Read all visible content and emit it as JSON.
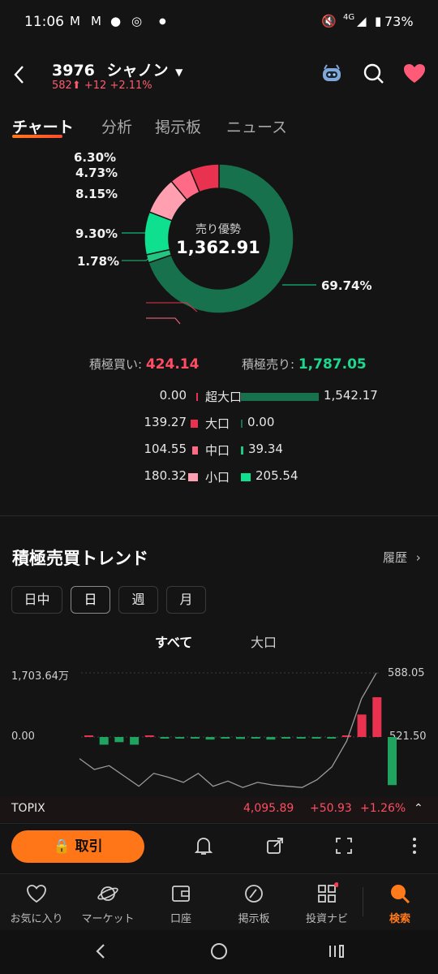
{
  "status": {
    "time": "11:06",
    "network": "4G",
    "battery": "73%"
  },
  "header": {
    "code": "3976",
    "name": "シャノン",
    "price": "582",
    "change": "+12",
    "change_pct": "+2.11%"
  },
  "tabs": [
    "チャート",
    "分析",
    "掲示板",
    "ニュース"
  ],
  "donut": {
    "center_label": "売り優勢",
    "center_value": "1,362.91",
    "labels": [
      "6.30%",
      "4.73%",
      "8.15%",
      "9.30%",
      "1.78%",
      "69.74%"
    ],
    "slices": [
      {
        "pct": 69.74,
        "color": "#17714d"
      },
      {
        "pct": 1.78,
        "color": "#23c583"
      },
      {
        "pct": 9.3,
        "color": "#0fe08f"
      },
      {
        "pct": 8.15,
        "color": "#ff9fb0"
      },
      {
        "pct": 4.73,
        "color": "#ff6b86"
      },
      {
        "pct": 6.3,
        "color": "#e8324f"
      }
    ]
  },
  "summary": {
    "buy_label": "積極買い:",
    "buy_value": "424.14",
    "sell_label": "積極売り:",
    "sell_value": "1,787.05"
  },
  "breakdown": [
    {
      "buy": "0.00",
      "name": "超大口",
      "sell": "1,542.17",
      "buy_frac": 0.0,
      "sell_frac": 1.0
    },
    {
      "buy": "139.27",
      "name": "大口",
      "sell": "0.00",
      "buy_frac": 0.09,
      "sell_frac": 0.0
    },
    {
      "buy": "104.55",
      "name": "中口",
      "sell": "39.34",
      "buy_frac": 0.07,
      "sell_frac": 0.03
    },
    {
      "buy": "180.32",
      "name": "小口",
      "sell": "205.54",
      "buy_frac": 0.12,
      "sell_frac": 0.13
    }
  ],
  "trend": {
    "title": "積極売買トレンド",
    "history": "履歴",
    "periods": [
      "日中",
      "日",
      "週",
      "月"
    ],
    "selected_period": "日",
    "subtabs": [
      "すべて",
      "大口"
    ],
    "left_top": "1,703.64万",
    "left_mid": "0.00",
    "right_top": "588.05",
    "right_mid": "521.50"
  },
  "chart_data": {
    "type": "bar",
    "series": [
      {
        "values": [
          0.02,
          -0.12,
          -0.08,
          -0.12,
          0.02,
          -0.02,
          -0.02,
          -0.02,
          -0.04,
          -0.02,
          -0.03,
          -0.02,
          -0.04,
          -0.02,
          -0.02,
          -0.02,
          -0.02,
          0.02,
          0.35,
          0.62,
          -0.75
        ]
      },
      {
        "values": [
          521.5,
          513,
          516,
          508,
          500,
          510,
          507,
          503,
          510,
          500,
          504,
          499,
          503,
          501,
          500,
          499,
          505,
          515,
          535,
          568,
          588
        ]
      }
    ]
  },
  "ticker": {
    "name": "TOPIX",
    "value": "4,095.89",
    "change": "+50.93",
    "pct": "+1.26%"
  },
  "actions": {
    "trade": "取引"
  },
  "bottom_nav": [
    "お気に入り",
    "マーケット",
    "口座",
    "掲示板",
    "投資ナビ",
    "検索"
  ]
}
